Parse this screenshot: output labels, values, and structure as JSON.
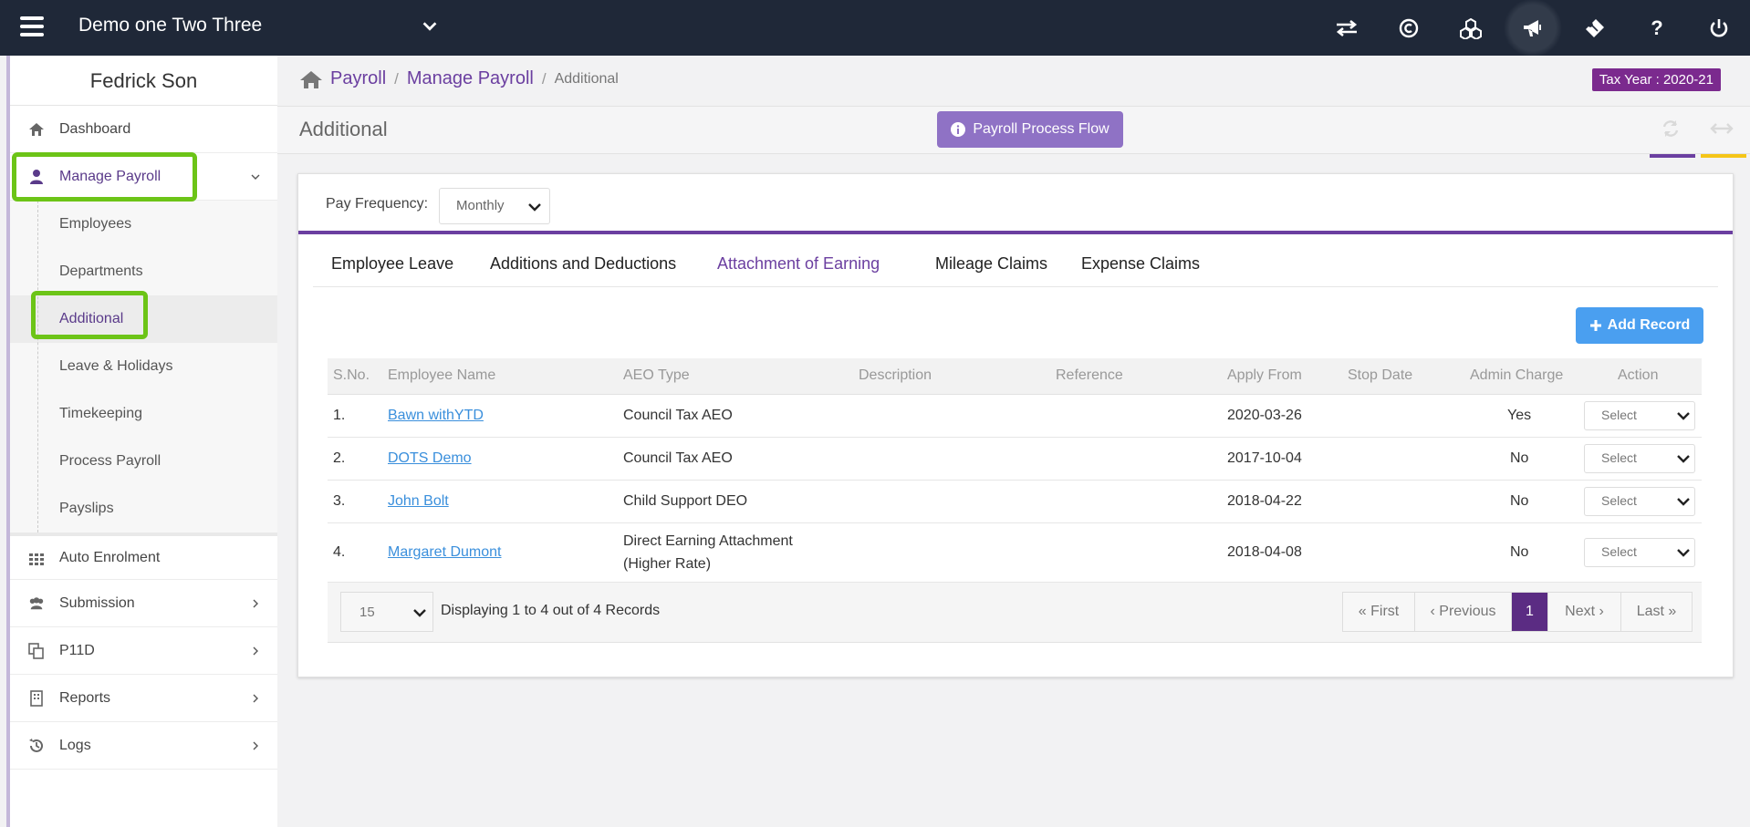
{
  "topbar": {
    "company": "Demo one Two Three",
    "icons": [
      "transfer-icon",
      "copyright-icon",
      "cubes-icon",
      "megaphone-icon",
      "ticket-icon",
      "help-icon",
      "power-icon"
    ]
  },
  "sidebar": {
    "user_name": "Fedrick Son",
    "items": {
      "dashboard": "Dashboard",
      "manage_payroll": "Manage Payroll",
      "auto_enrolment": "Auto Enrolment",
      "submission": "Submission",
      "p11d": "P11D",
      "reports": "Reports",
      "logs": "Logs"
    },
    "submenu": {
      "employees": "Employees",
      "departments": "Departments",
      "additional": "Additional",
      "leave_holidays": "Leave & Holidays",
      "timekeeping": "Timekeeping",
      "process_payroll": "Process Payroll",
      "payslips": "Payslips"
    }
  },
  "breadcrumb": {
    "payroll": "Payroll",
    "sep": "/",
    "manage_payroll": "Manage Payroll",
    "current": "Additional"
  },
  "tax_year": "Tax Year : 2020-21",
  "page": {
    "title": "Additional",
    "process_flow_label": "Payroll Process Flow"
  },
  "filter": {
    "label": "Pay Frequency:",
    "value": "Monthly"
  },
  "tabs": {
    "employee_leave": "Employee Leave",
    "additions_deductions": "Additions and Deductions",
    "attachment_of_earning": "Attachment of Earning",
    "mileage_claims": "Mileage Claims",
    "expense_claims": "Expense Claims"
  },
  "add_record_label": "Add Record",
  "table": {
    "headers": {
      "sno": "S.No.",
      "employee_name": "Employee Name",
      "aeo_type": "AEO Type",
      "description": "Description",
      "reference": "Reference",
      "apply_from": "Apply From",
      "stop_date": "Stop Date",
      "admin_charge": "Admin Charge",
      "action": "Action"
    },
    "rows": [
      {
        "sno": "1.",
        "name": "Bawn withYTD",
        "aeo": "Council Tax AEO",
        "aeo2": "",
        "apply_from": "2020-03-26",
        "admin": "Yes",
        "action": "Select"
      },
      {
        "sno": "2.",
        "name": "DOTS Demo",
        "aeo": "Council Tax AEO",
        "aeo2": "",
        "apply_from": "2017-10-04",
        "admin": "No",
        "action": "Select"
      },
      {
        "sno": "3.",
        "name": "John Bolt",
        "aeo": "Child Support DEO",
        "aeo2": "",
        "apply_from": "2018-04-22",
        "admin": "No",
        "action": "Select"
      },
      {
        "sno": "4.",
        "name": "Margaret Dumont",
        "aeo": "Direct Earning Attachment",
        "aeo2": "(Higher Rate)",
        "apply_from": "2018-04-08",
        "admin": "No",
        "action": "Select"
      }
    ]
  },
  "pagination": {
    "page_size": "15",
    "display_text": "Displaying 1 to 4 out of 4 Records",
    "first": "First",
    "previous": "Previous",
    "current": "1",
    "next": "Next",
    "last": "Last"
  },
  "colors": {
    "topbar": "#1f2838",
    "brand_purple": "#6b3fa0",
    "highlight_green": "#6cc417",
    "add_button": "#4a9ff0"
  }
}
